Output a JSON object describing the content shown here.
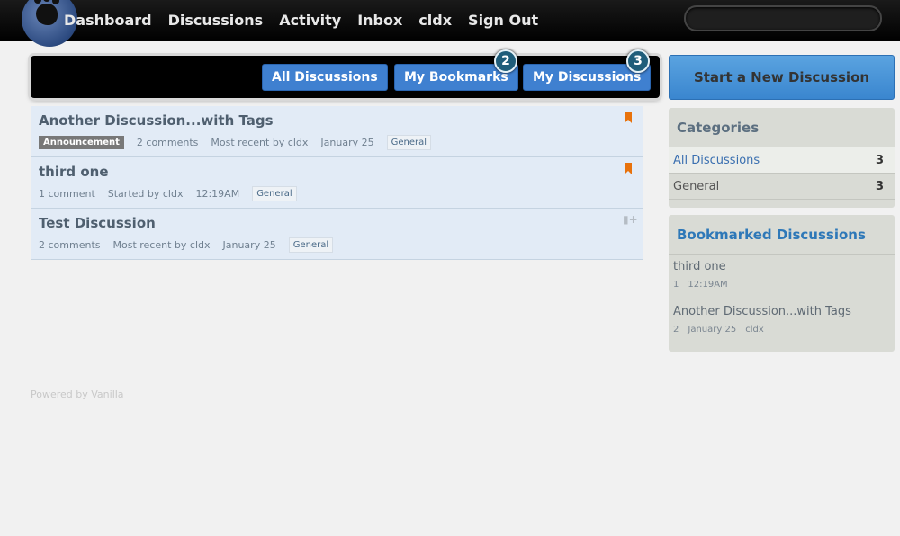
{
  "nav": {
    "items": [
      "Dashboard",
      "Discussions",
      "Activity",
      "Inbox",
      "cldx",
      "Sign Out"
    ],
    "search_placeholder": ""
  },
  "tabs": {
    "all": "All Discussions",
    "bookmarks": "My Bookmarks",
    "bookmarks_count": "2",
    "mine": "My Discussions",
    "mine_count": "3"
  },
  "discussions": [
    {
      "title": "Another Discussion...with Tags",
      "announcement": "Announcement",
      "comments": "2 comments",
      "activity": "Most recent by cldx",
      "date": "January 25",
      "category": "General",
      "bookmarked": true
    },
    {
      "title": "third one",
      "comments": "1 comment",
      "activity": "Started by cldx",
      "date": "12:19AM",
      "category": "General",
      "bookmarked": true
    },
    {
      "title": "Test Discussion",
      "comments": "2 comments",
      "activity": "Most recent by cldx",
      "date": "January 25",
      "category": "General",
      "bookmarked": false
    }
  ],
  "footer": {
    "powered": "Powered by Vanilla"
  },
  "sidebar": {
    "new_discussion": "Start a New Discussion",
    "categories_title": "Categories",
    "categories": [
      {
        "name": "All Discussions",
        "count": "3"
      },
      {
        "name": "General",
        "count": "3"
      }
    ],
    "bookmarked_title": "Bookmarked Discussions",
    "bookmarked": [
      {
        "title": "third one",
        "count": "1",
        "date": "12:19AM",
        "user": ""
      },
      {
        "title": "Another Discussion...with Tags",
        "count": "2",
        "date": "January 25",
        "user": "cldx"
      }
    ]
  },
  "colors": {
    "accent": "#3f80d0",
    "bookmark": "#e8720c",
    "topbar": "#000000"
  }
}
